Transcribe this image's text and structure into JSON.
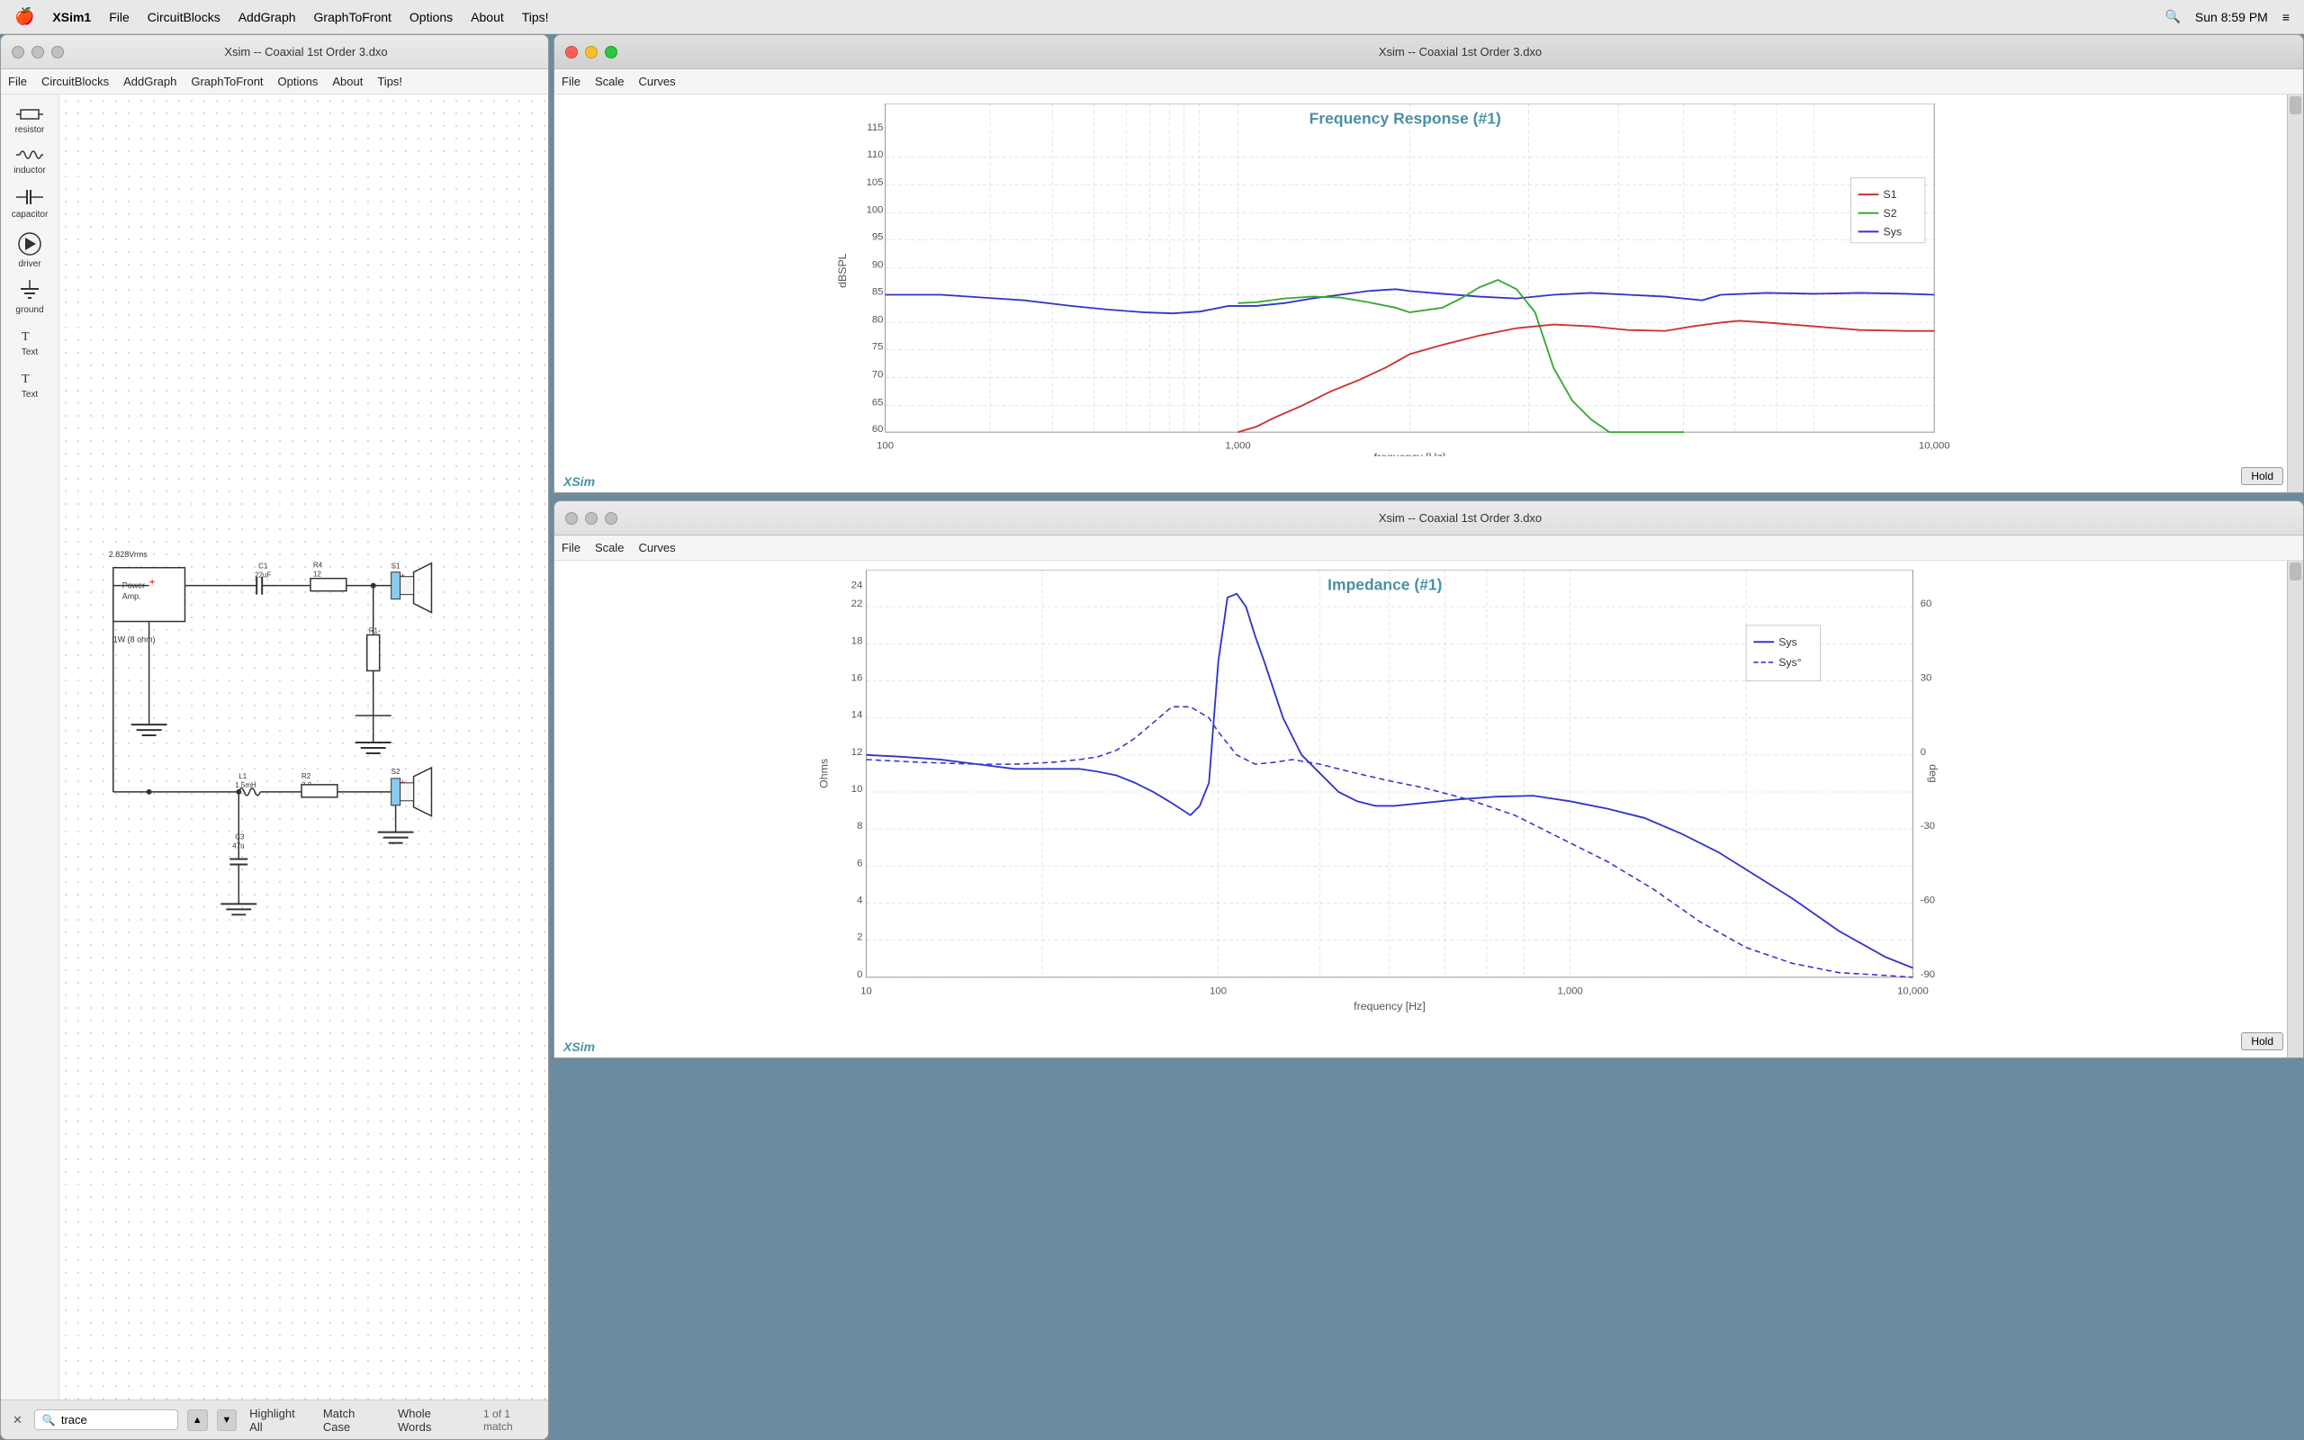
{
  "menubar": {
    "apple": "🍎",
    "app_name": "XSim1",
    "time": "Sun 8:59 PM",
    "items": [
      "File",
      "CircuitBlocks",
      "AddGraph",
      "GraphToFront",
      "Options",
      "About",
      "Tips!"
    ]
  },
  "circuit_window": {
    "title": "Xsim -- Coaxial 1st Order 3.dxo",
    "menu_items": [
      "File",
      "CircuitBlocks",
      "AddGraph",
      "GraphToFront",
      "Options",
      "About",
      "Tips!"
    ],
    "tools": [
      {
        "name": "resistor",
        "icon": "⬛",
        "label": "resistor"
      },
      {
        "name": "inductor",
        "icon": "〰",
        "label": "inductor"
      },
      {
        "name": "capacitor",
        "icon": "⊣⊢",
        "label": "capacitor"
      },
      {
        "name": "driver",
        "icon": "🔊",
        "label": "driver"
      },
      {
        "name": "ground",
        "icon": "⏚",
        "label": "ground"
      },
      {
        "name": "text1",
        "icon": "",
        "label": "Text"
      },
      {
        "name": "text2",
        "icon": "",
        "label": "Text"
      }
    ]
  },
  "freq_window": {
    "title": "Xsim -- Coaxial 1st Order 3.dxo",
    "menu_items": [
      "File",
      "Scale",
      "Curves"
    ],
    "graph_title": "Frequency Response (#1)",
    "x_label": "frequency [Hz]",
    "y_label": "dBSPL",
    "x_min": 100,
    "x_max": 10000,
    "y_min": 60,
    "y_max": 120,
    "legend": [
      {
        "label": "S1",
        "color": "#cc3333"
      },
      {
        "label": "S2",
        "color": "#33aa33"
      },
      {
        "label": "Sys",
        "color": "#3333cc"
      }
    ],
    "hold_label": "Hold",
    "xsim_label": "XSim"
  },
  "imp_window": {
    "title": "Xsim -- Coaxial 1st Order 3.dxo",
    "menu_items": [
      "File",
      "Scale",
      "Curves"
    ],
    "graph_title": "Impedance (#1)",
    "x_label": "frequency [Hz]",
    "y_label_left": "Ohms",
    "y_label_right": "deg",
    "legend": [
      {
        "label": "Sys",
        "color": "#3333cc",
        "dash": false
      },
      {
        "label": "Sys°",
        "color": "#3333cc",
        "dash": true
      }
    ],
    "hold_label": "Hold",
    "xsim_label": "XSim"
  },
  "search_bar": {
    "value": "trace",
    "placeholder": "trace",
    "highlight_all": "Highlight All",
    "match_case": "Match Case",
    "whole_words": "Whole Words",
    "status": "1 of 1 match",
    "close_icon": "✕",
    "up_icon": "▲",
    "down_icon": "▼"
  },
  "schematic": {
    "voltage_label": "2.828Vrms",
    "power_amp_label": "Power\nAmp.",
    "load_label": "1W (8 ohm)",
    "c1_label": "C1\n22uF",
    "r4_label": "R4\n12",
    "s1_label": "S1",
    "r1_label": "R1-\n2.4",
    "l1_label": "L1\n1.5mH",
    "r2_label": "R2\n3.3",
    "c3_label": "C3\n47u",
    "s2_label": "S2"
  }
}
